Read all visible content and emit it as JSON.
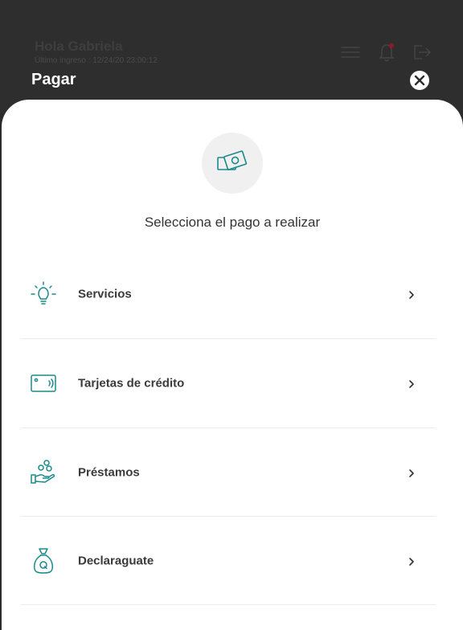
{
  "header": {
    "greeting": "Hola Gabriela",
    "last_login": "Último ingreso : 12/24/20 23:00:12",
    "icons": [
      "menu-icon",
      "bell-icon",
      "logout-icon"
    ],
    "notification_dot_color": "#c8102e"
  },
  "page": {
    "title": "Pagar",
    "subtitle": "Selecciona el pago a realizar",
    "close_icon": "close-icon",
    "hero_icon": "money-bills-icon"
  },
  "options": [
    {
      "label": "Servicios",
      "icon": "lightbulb-icon"
    },
    {
      "label": "Tarjetas de crédito",
      "icon": "credit-card-icon"
    },
    {
      "label": "Préstamos",
      "icon": "hand-coins-icon"
    },
    {
      "label": "Declaraguate",
      "icon": "money-bag-icon"
    }
  ],
  "colors": {
    "accent": "#1a8a8a",
    "overlay": "#2c2c2c",
    "sheet": "#ffffff"
  }
}
